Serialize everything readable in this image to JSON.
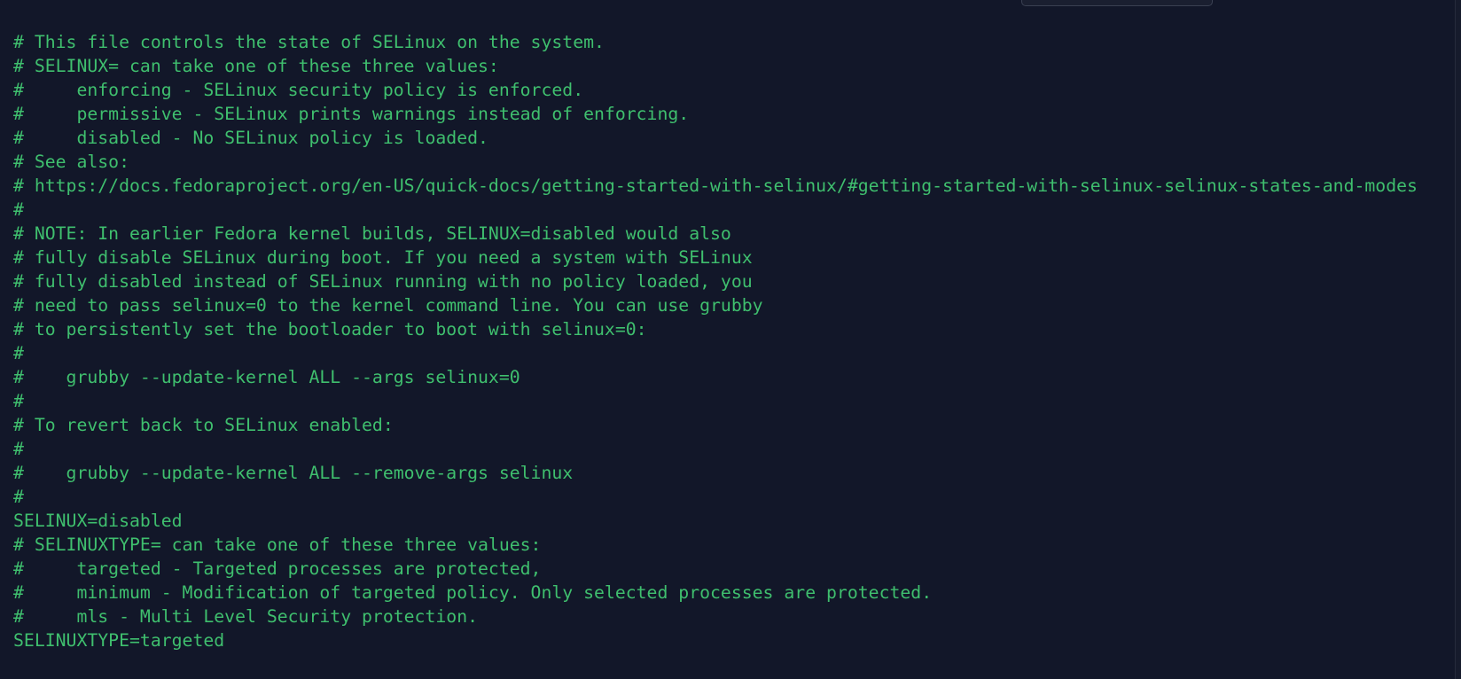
{
  "editor": {
    "lines": [
      "# This file controls the state of SELinux on the system.",
      "# SELINUX= can take one of these three values:",
      "#     enforcing - SELinux security policy is enforced.",
      "#     permissive - SELinux prints warnings instead of enforcing.",
      "#     disabled - No SELinux policy is loaded.",
      "# See also:",
      "# https://docs.fedoraproject.org/en-US/quick-docs/getting-started-with-selinux/#getting-started-with-selinux-selinux-states-and-modes",
      "#",
      "# NOTE: In earlier Fedora kernel builds, SELINUX=disabled would also",
      "# fully disable SELinux during boot. If you need a system with SELinux",
      "# fully disabled instead of SELinux running with no policy loaded, you",
      "# need to pass selinux=0 to the kernel command line. You can use grubby",
      "# to persistently set the bootloader to boot with selinux=0:",
      "#",
      "#    grubby --update-kernel ALL --args selinux=0",
      "#",
      "# To revert back to SELinux enabled:",
      "#",
      "#    grubby --update-kernel ALL --remove-args selinux",
      "#",
      "SELINUX=disabled",
      "# SELINUXTYPE= can take one of these three values:",
      "#     targeted - Targeted processes are protected,",
      "#     minimum - Modification of targeted policy. Only selected processes are protected.",
      "#     mls - Multi Level Security protection.",
      "SELINUXTYPE=targeted"
    ]
  },
  "colors": {
    "background": "#121729",
    "text": "#3fbf6e"
  }
}
